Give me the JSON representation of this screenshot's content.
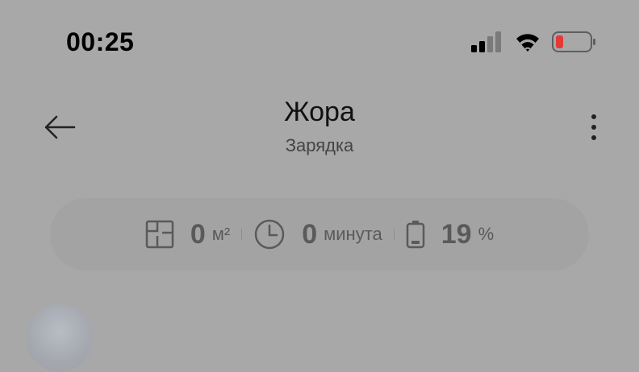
{
  "status_bar": {
    "time": "00:25",
    "battery_color": "#e53935"
  },
  "header": {
    "title": "Жора",
    "subtitle": "Зарядка"
  },
  "stats": {
    "area": {
      "value": "0",
      "unit": "м²",
      "icon": "floor-plan-icon"
    },
    "time": {
      "value": "0",
      "unit": "минута",
      "icon": "clock-icon"
    },
    "battery": {
      "value": "19",
      "unit": "%",
      "icon": "battery-icon"
    }
  }
}
